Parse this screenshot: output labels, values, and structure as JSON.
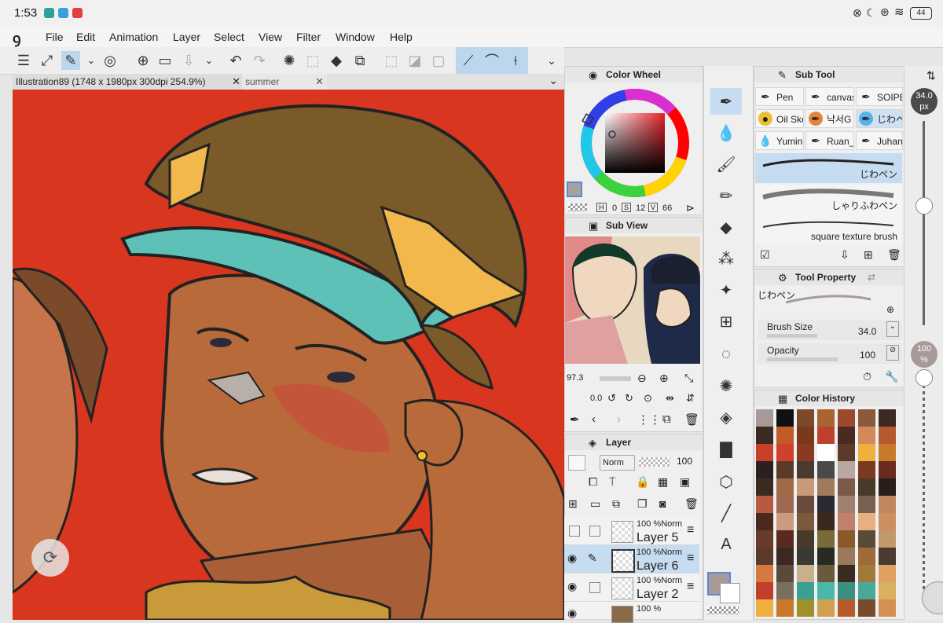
{
  "status_bar": {
    "time": "1:53",
    "battery": "44"
  },
  "menu": [
    "File",
    "Edit",
    "Animation",
    "Layer",
    "Select",
    "View",
    "Filter",
    "Window",
    "Help"
  ],
  "tabs": [
    {
      "label": "Illustration89 (1748 x 1980px 300dpi 254.9%)",
      "active": true
    },
    {
      "label": "summer",
      "active": false
    }
  ],
  "color_wheel": {
    "title": "Color Wheel",
    "h_label": "H",
    "h": "0",
    "s_label": "S",
    "s": "12",
    "v_label": "V",
    "v": "66"
  },
  "sub_view": {
    "title": "Sub View",
    "zoom": "97.3",
    "rotation": "0.0"
  },
  "layer_panel": {
    "title": "Layer",
    "blend_mode": "Norm",
    "opacity": "100",
    "layers": [
      {
        "name": "Layer 5",
        "info": "100 %Norm",
        "visible": false,
        "selected": false
      },
      {
        "name": "Layer 6",
        "info": "100 %Norm",
        "visible": true,
        "selected": true
      },
      {
        "name": "Layer 2",
        "info": "100 %Norm",
        "visible": true,
        "selected": false
      },
      {
        "name": "",
        "info": "100 %",
        "visible": true,
        "selected": false
      }
    ]
  },
  "sub_tool": {
    "title": "Sub Tool",
    "groups": [
      "Pen",
      "canvas",
      "SOIPEN",
      "Oil Sketch",
      "낙서G",
      "じわペ",
      "Yumin",
      "Ruan_",
      "Juhani"
    ],
    "brushes": [
      "じわペン",
      "しゃりふわペン",
      "square texture brush"
    ]
  },
  "tool_property": {
    "title": "Tool Property",
    "brush_name": "じわペン",
    "size_label": "Brush Size",
    "size_value": "34.0",
    "opacity_label": "Opacity",
    "opacity_value": "100"
  },
  "color_history": {
    "title": "Color History",
    "colors": [
      "#a89a98",
      "#111111",
      "#7a4a2a",
      "#a8652f",
      "#9c4a2e",
      "#8a5a3a",
      "#3a2a22",
      "#3b2a22",
      "#c35a2a",
      "#7a3a1a",
      "#c04030",
      "#4a2b1f",
      "#d28a5a",
      "#b45a2e",
      "#c9402a",
      "#d0402a",
      "#8a3a22",
      "#ffffff",
      "#5a3a2a",
      "#f0b040",
      "#c87a2a",
      "#2a2020",
      "#5a3a28",
      "#4a3a30",
      "#4a4a4a",
      "#b8a8a0",
      "#7a3a22",
      "#6a2a1e",
      "#3a2a22",
      "#a06a48",
      "#c89a7a",
      "#a07a5a",
      "#7a5a4a",
      "#4a3a2a",
      "#2a1e1a",
      "#b85a40",
      "#a06a50",
      "#6a4a3a",
      "#2a2a33",
      "#a08070",
      "#7a6050",
      "#c0885e",
      "#4a2a1e",
      "#cc9a80",
      "#7a5a3a",
      "#3a2a1e",
      "#c0806a",
      "#e8b080",
      "#cc9060",
      "#6a3a2a",
      "#5a2a1e",
      "#4a3a2a",
      "#7a6a3a",
      "#8a5a2a",
      "#5a4a3a",
      "#c09a6a",
      "#5a3a2a",
      "#3a2a22",
      "#3a3a33",
      "#2a2a22",
      "#9a7a5a",
      "#a06a3a",
      "#4a3a30",
      "#d47a40",
      "#5a4a3a",
      "#c8b088",
      "#6a5a3a",
      "#3a2a22",
      "#a07a3a",
      "#e0a060",
      "#c0402a",
      "#7a7060",
      "#3aa090",
      "#4ab8a8",
      "#3a9080",
      "#4aa898",
      "#d8b060",
      "#f0b040",
      "#c87a2a",
      "#a0902a",
      "#d0a050",
      "#b85a2a",
      "#7a4a2a",
      "#d49050"
    ]
  },
  "right_panel": {
    "size_readout": "34.0",
    "size_unit": "px",
    "opacity_readout": "100",
    "opacity_unit": "%"
  },
  "icons": [
    "menu-icon",
    "rotate-icon",
    "undo-icon",
    "redo-icon",
    "pen-icon",
    "eraser-icon",
    "text-icon",
    "fill-icon",
    "gradient-icon",
    "eyedropper-icon"
  ]
}
